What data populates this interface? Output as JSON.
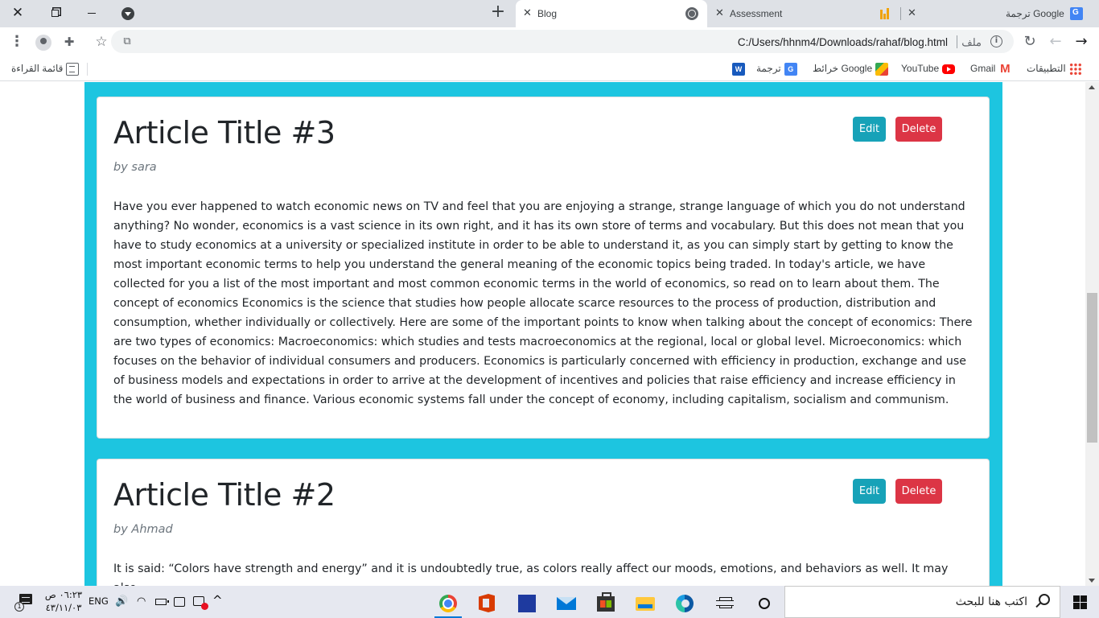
{
  "window_controls": {
    "close_glyph": "✕",
    "restore_label": "",
    "minimize_label": ""
  },
  "tabs": [
    {
      "label": "Blog",
      "icon": "globe-icon",
      "active": true
    },
    {
      "label": "Assessment",
      "icon": "bar-chart-icon",
      "active": false
    },
    {
      "label": "ترجمة Google",
      "icon": "google-translate-icon",
      "active": false
    }
  ],
  "tab_glyphs": {
    "close": "✕",
    "new_tab": "+"
  },
  "toolbar": {
    "url": "C:/Users/hhnm4/Downloads/rahaf/blog.html",
    "scheme_label": "ملف",
    "info_glyph": "i",
    "menu_glyph": "⋮",
    "extensions_glyph": "✚",
    "star_glyph": "☆",
    "cast_glyph": "⧉",
    "reload_glyph": "↻",
    "back_glyph": "←",
    "forward_glyph": "→"
  },
  "bookmarks": {
    "reading_list": "قائمة القراءة",
    "items": [
      {
        "label": "",
        "icon": "word-icon",
        "glyph": "W"
      },
      {
        "label": "ترجمة",
        "icon": "google-translate-icon",
        "glyph": "G"
      },
      {
        "label": "خرائط Google",
        "icon": "google-maps-icon"
      },
      {
        "label": "YouTube",
        "icon": "youtube-icon"
      },
      {
        "label": "Gmail",
        "icon": "gmail-icon",
        "glyph": "M"
      },
      {
        "label": "التطبيقات",
        "icon": "apps-grid-icon"
      }
    ]
  },
  "page": {
    "background_color": "#1dc5e0",
    "articles": [
      {
        "title": "Article Title #3",
        "author": "by sara",
        "body": "Have you ever happened to watch economic news on TV and feel that you are enjoying a strange, strange language of which you do not understand anything? No wonder, economics is a vast science in its own right, and it has its own store of terms and vocabulary. But this does not mean that you have to study economics at a university or specialized institute in order to be able to understand it, as you can simply start by getting to know the most important economic terms to help you understand the general meaning of the economic topics being traded. In today's article, we have collected for you a list of the most important and most common economic terms in the world of economics, so read on to learn about them. The concept of economics Economics is the science that studies how people allocate scarce resources to the process of production, distribution and consumption, whether individually or collectively. Here are some of the important points to know when talking about the concept of economics: There are two types of economics: Macroeconomics: which studies and tests macroeconomics at the regional, local or global level. Microeconomics: which focuses on the behavior of individual consumers and producers. Economics is particularly concerned with efficiency in production, exchange and use of business models and expectations in order to arrive at the development of incentives and policies that raise efficiency and increase efficiency in the world of business and finance. Various economic systems fall under the concept of economy, including capitalism, socialism and communism.",
        "edit_label": "Edit",
        "delete_label": "Delete"
      },
      {
        "title": "Article Title #2",
        "author": "by Ahmad",
        "body": "It is said: “Colors have strength and energy” and it is undoubtedly true, as colors really affect our moods, emotions, and behaviors as well. It may also",
        "edit_label": "Edit",
        "delete_label": "Delete"
      }
    ],
    "colors": {
      "edit": "#17a2b8",
      "delete": "#dc3545"
    }
  },
  "taskbar": {
    "time": "٠٦:٢٣ ص",
    "date": "٤٣/١١/٠٣",
    "language": "ENG",
    "notification_count": "1",
    "volume_glyph": "🔊",
    "wifi_glyph": "◠",
    "chevron_glyph": "^",
    "search_placeholder": "اكتب هنا للبحث",
    "pinned_apps": [
      "chrome-icon",
      "office-icon",
      "photoshop-icon",
      "mail-icon",
      "store-icon",
      "file-explorer-icon",
      "edge-icon",
      "task-view-icon",
      "cortana-icon"
    ]
  }
}
